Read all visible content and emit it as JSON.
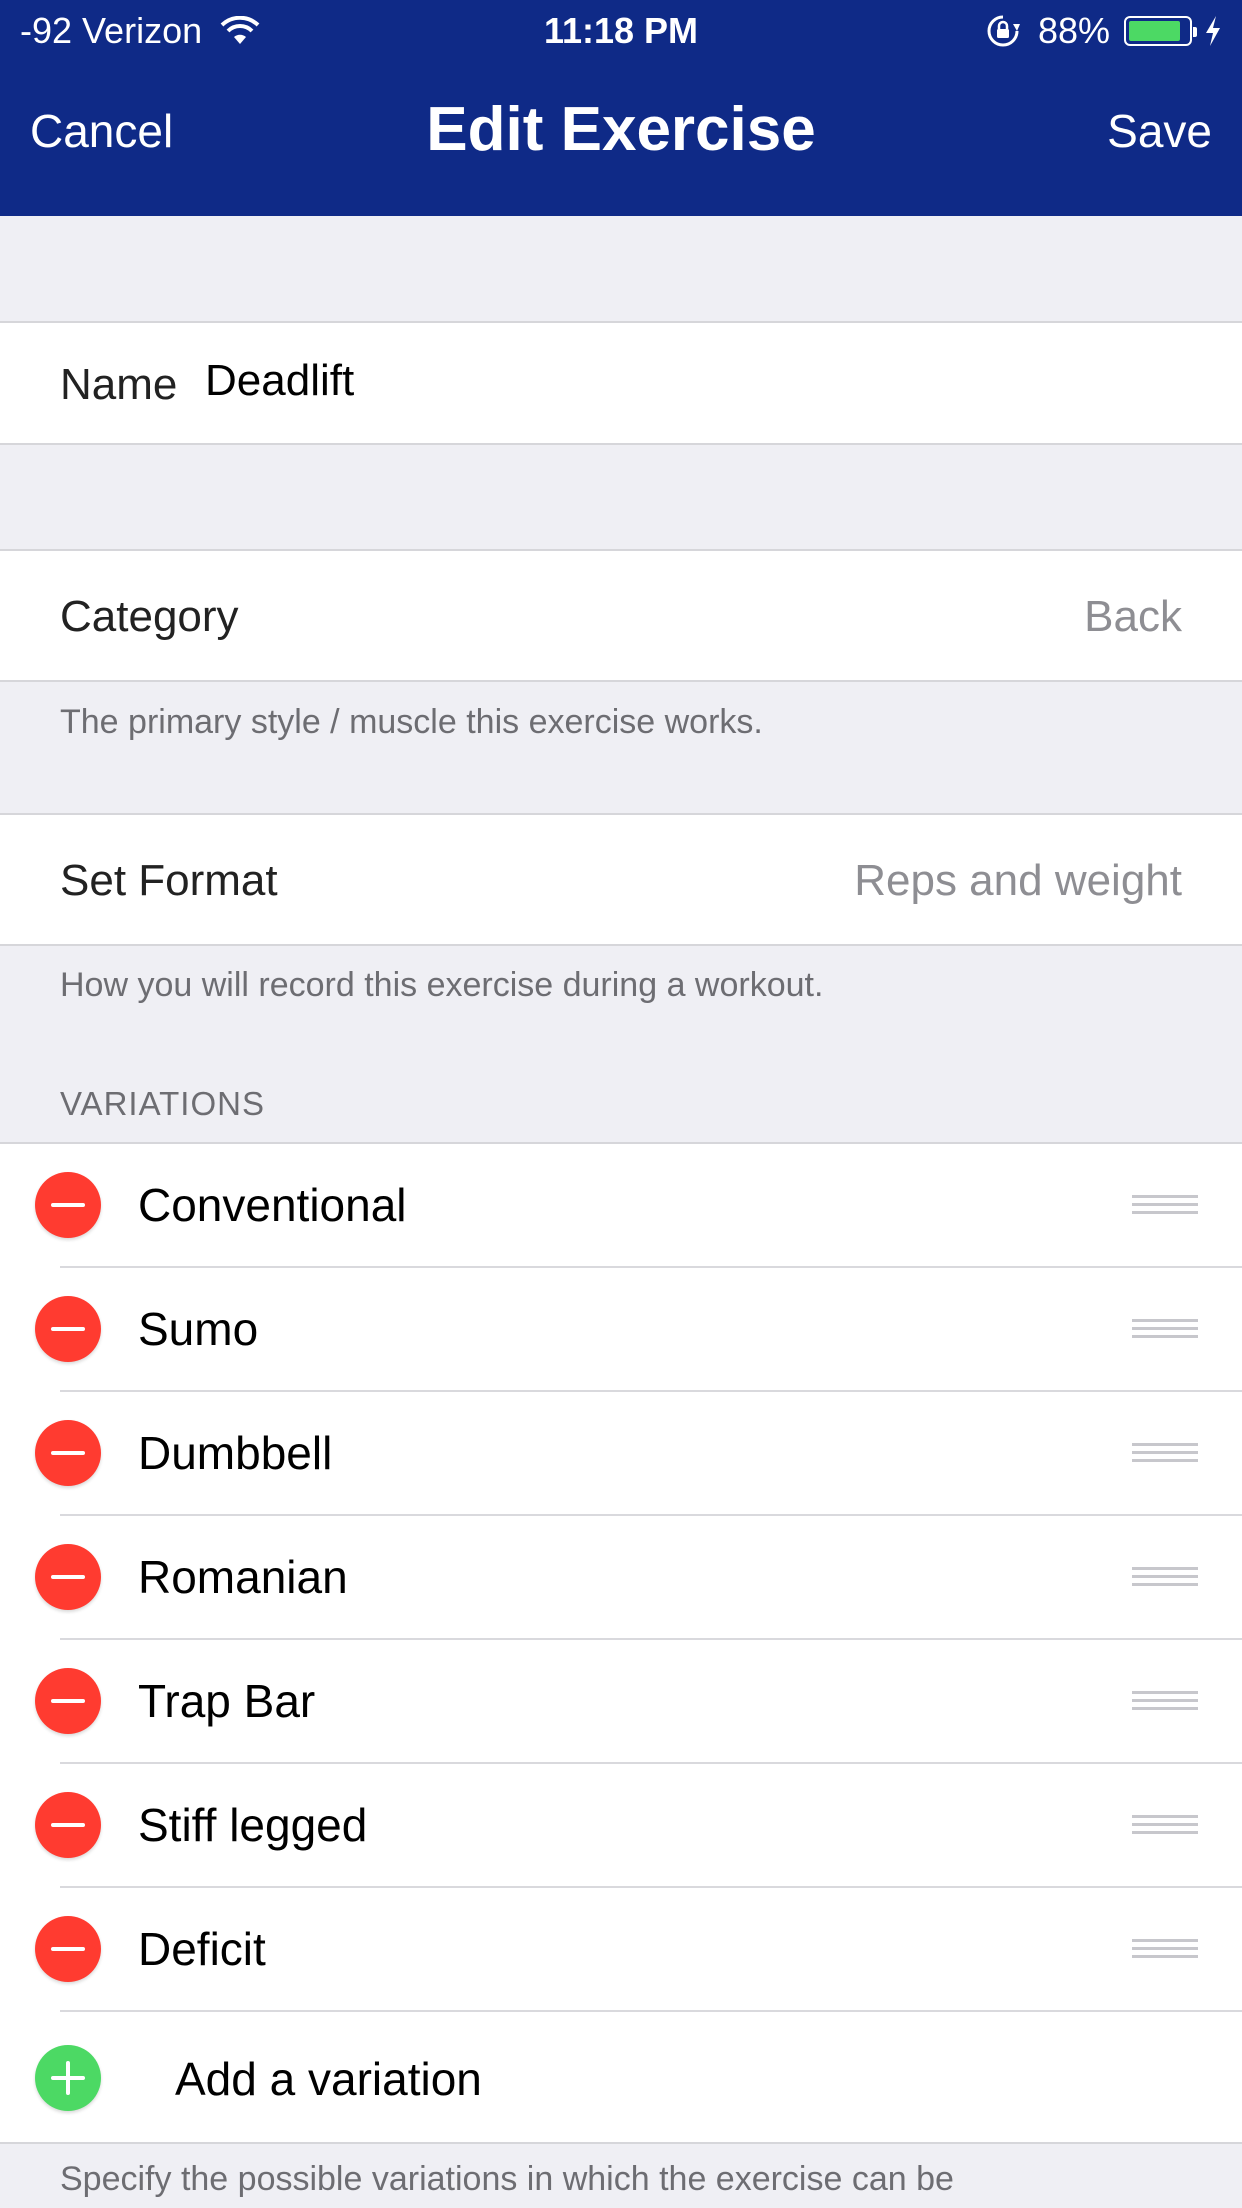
{
  "status_bar": {
    "carrier": "-92 Verizon",
    "time": "11:18 PM",
    "battery_percent": "88%",
    "battery_level": 0.88,
    "icons": [
      "wifi-icon",
      "orientation-lock-icon",
      "battery-icon",
      "charging-bolt-icon"
    ]
  },
  "nav": {
    "cancel_label": "Cancel",
    "title": "Edit Exercise",
    "save_label": "Save"
  },
  "name_cell": {
    "label": "Name",
    "value": "Deadlift"
  },
  "category_cell": {
    "label": "Category",
    "value": "Back",
    "footer": "The primary style / muscle this exercise works."
  },
  "set_format_cell": {
    "label": "Set Format",
    "value": "Reps and weight",
    "footer": "How you will record this exercise during a workout."
  },
  "variations": {
    "header": "VARIATIONS",
    "items": [
      {
        "label": "Conventional"
      },
      {
        "label": "Sumo"
      },
      {
        "label": "Dumbbell"
      },
      {
        "label": "Romanian"
      },
      {
        "label": "Trap Bar"
      },
      {
        "label": "Stiff legged"
      },
      {
        "label": "Deficit"
      }
    ],
    "add_label": "Add a variation",
    "footer": "Specify the possible variations in which the exercise can be"
  },
  "colors": {
    "nav_background": "#0f2a87",
    "delete_red": "#ff3b30",
    "add_green": "#4cd964",
    "battery_green": "#4cd964",
    "group_background": "#efeff4"
  }
}
